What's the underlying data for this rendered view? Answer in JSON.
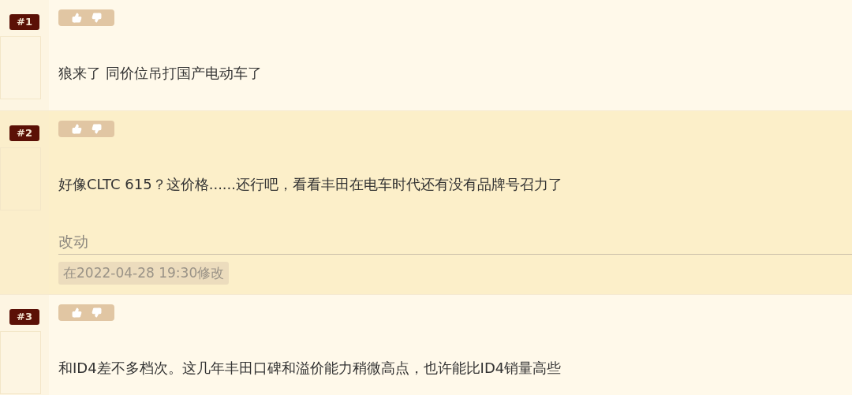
{
  "posts": [
    {
      "floor": "#1",
      "text": "狼来了 同价位吊打国产电动车了",
      "highlighted": false
    },
    {
      "floor": "#2",
      "text": "好像CLTC 615？这价格......还行吧，看看丰田在电车时代还有没有品牌号召力了",
      "highlighted": true,
      "edit": {
        "label": "改动",
        "note": "在2022-04-28 19:30修改"
      }
    },
    {
      "floor": "#3",
      "text": "和ID4差不多档次。这几年丰田口碑和溢价能力稍微高点，也许能比ID4销量高些",
      "highlighted": false
    }
  ]
}
